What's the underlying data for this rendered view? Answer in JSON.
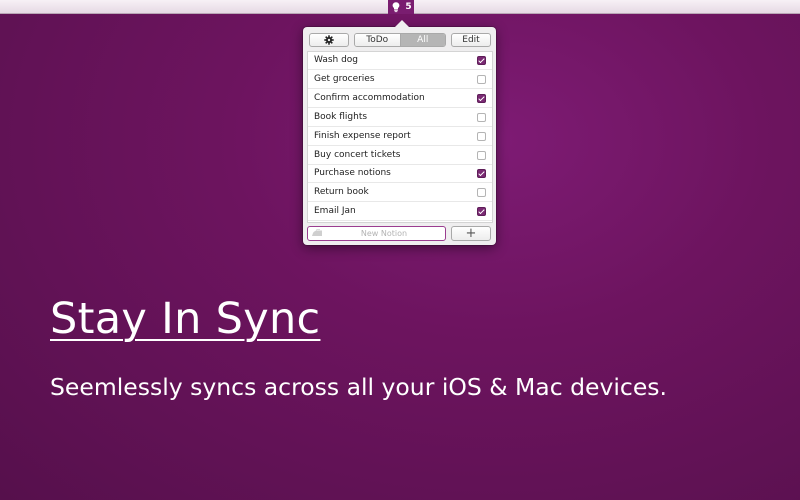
{
  "menubar": {
    "status_icon": "lightbulb-icon",
    "status_count": "5",
    "accent": "#7a1d70"
  },
  "popover": {
    "toolbar": {
      "settings_icon": "gear-icon",
      "segments": [
        {
          "label": "ToDo",
          "active": false
        },
        {
          "label": "All",
          "active": true
        }
      ],
      "edit_label": "Edit"
    },
    "tasks": [
      {
        "label": "Wash dog",
        "checked": true
      },
      {
        "label": "Get groceries",
        "checked": false
      },
      {
        "label": "Confirm accommodation",
        "checked": true
      },
      {
        "label": "Book flights",
        "checked": false
      },
      {
        "label": "Finish expense report",
        "checked": false
      },
      {
        "label": "Buy concert tickets",
        "checked": false
      },
      {
        "label": "Purchase notions",
        "checked": true
      },
      {
        "label": "Return book",
        "checked": false
      },
      {
        "label": "Email Jan",
        "checked": true
      }
    ],
    "new_item": {
      "icon": "iron-icon",
      "placeholder": "New Notion",
      "value": ""
    },
    "add_label": "+"
  },
  "hero": {
    "headline": "Stay In Sync",
    "subline": "Seemlessly syncs across all your iOS & Mac devices."
  },
  "colors": {
    "background": "#6d145f",
    "checkbox_checked": "#7a2a73"
  }
}
